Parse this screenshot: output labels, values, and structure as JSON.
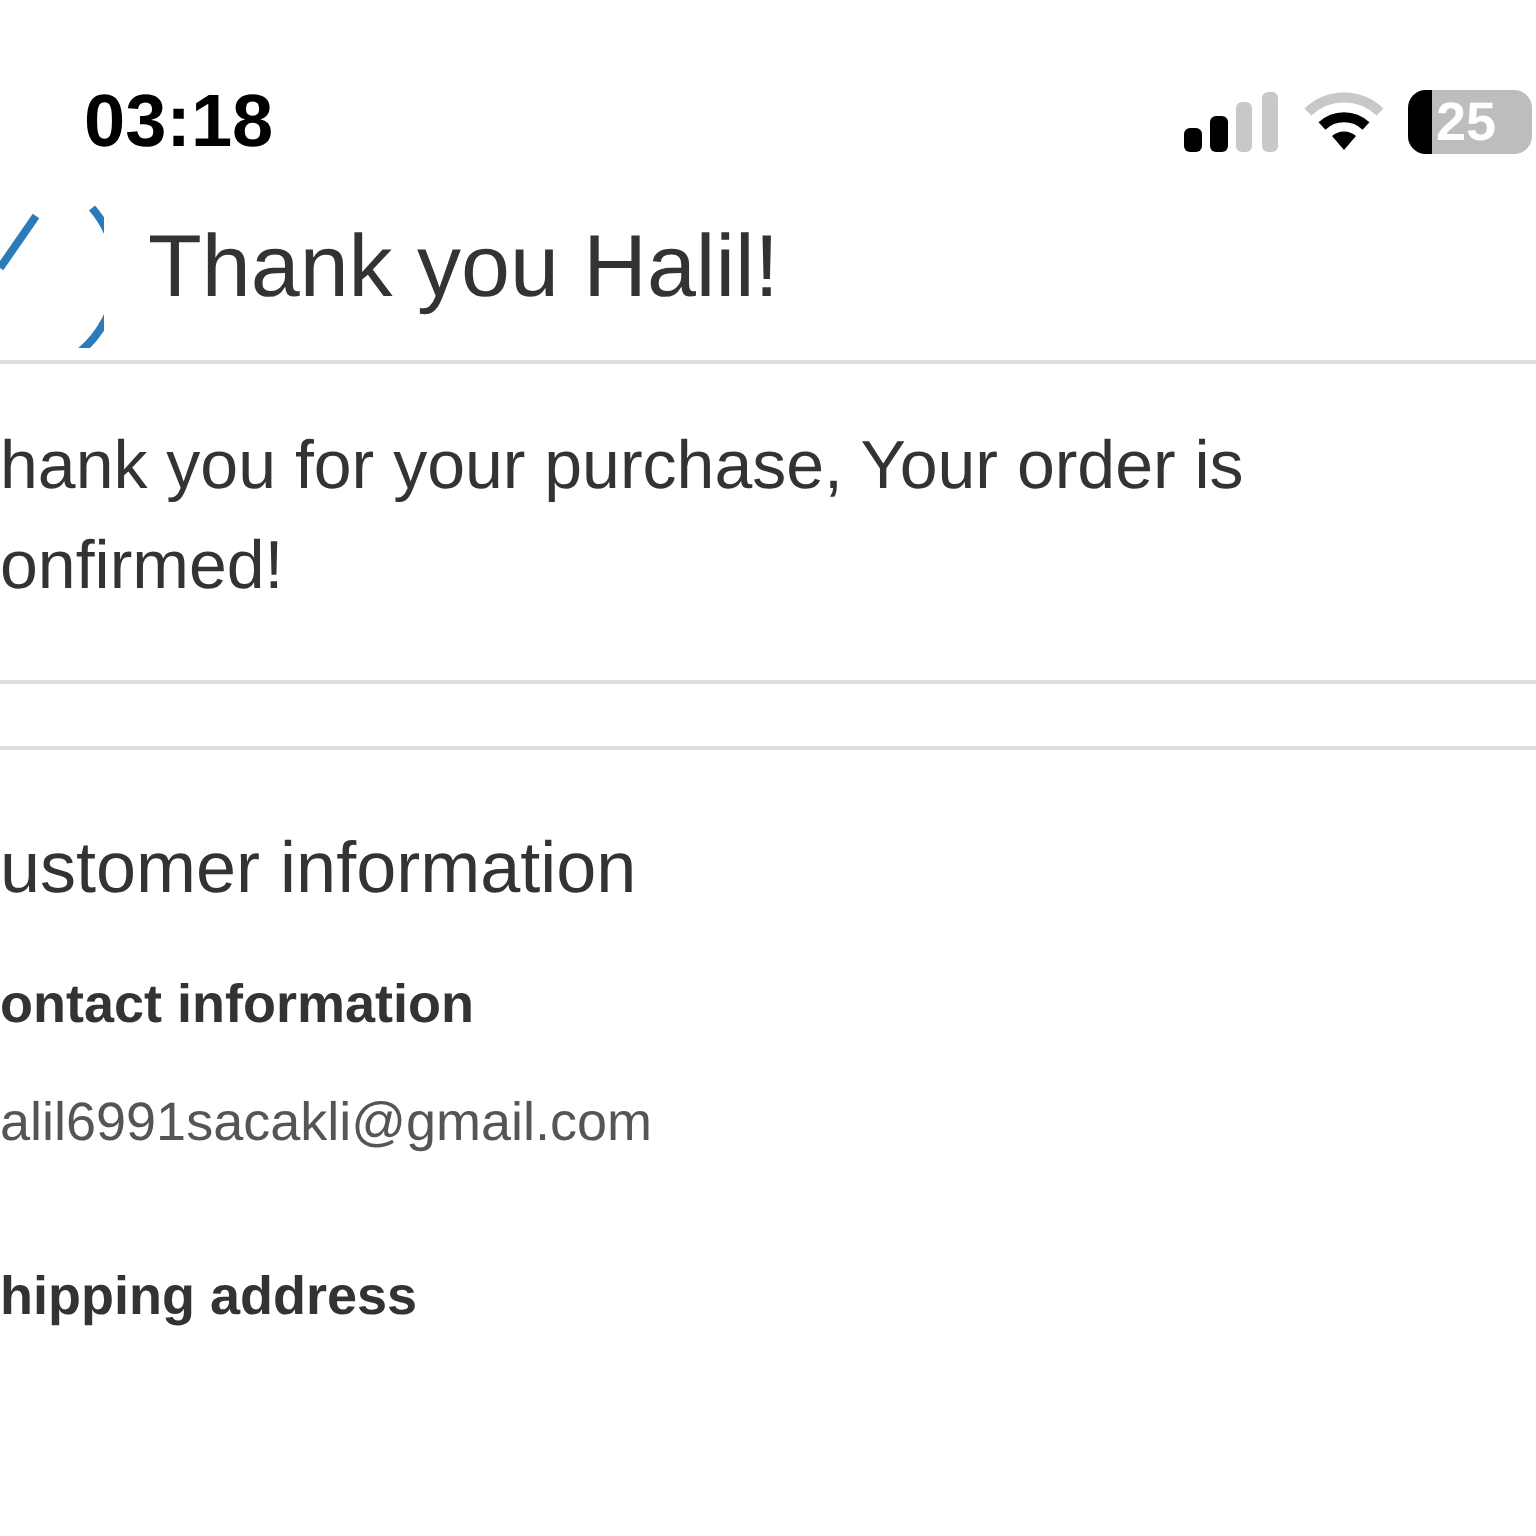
{
  "status_bar": {
    "time": "03:18",
    "battery": "25"
  },
  "header": {
    "title": "Thank you Halil!"
  },
  "message": {
    "lines": [
      "hank you for your purchase, Your order is",
      "onfirmed!"
    ]
  },
  "customer_information": {
    "heading": "ustomer information",
    "sections": [
      {
        "label": "ontact information",
        "value": "alil6991sacakli@gmail.com"
      },
      {
        "label": "hipping address"
      }
    ]
  }
}
